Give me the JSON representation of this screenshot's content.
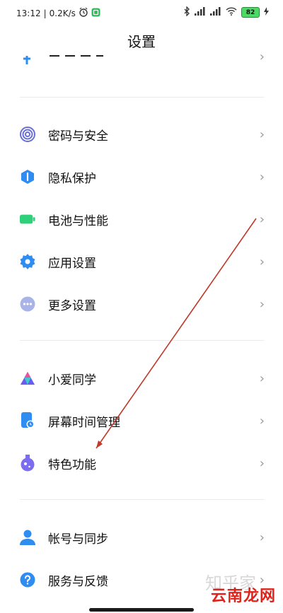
{
  "status_bar": {
    "time": "13:12",
    "net_speed": "0.2K/s",
    "battery_level": "82"
  },
  "header": {
    "title": "设置"
  },
  "sections": [
    {
      "items": [
        {
          "label": "密码与安全",
          "icon": "fingerprint-icon",
          "color": "#6a6fd8"
        },
        {
          "label": "隐私保护",
          "icon": "privacy-shield-icon",
          "color": "#2f8cf0"
        },
        {
          "label": "电池与性能",
          "icon": "battery-icon",
          "color": "#2fd07a"
        },
        {
          "label": "应用设置",
          "icon": "gear-icon",
          "color": "#2f8cf0"
        },
        {
          "label": "更多设置",
          "icon": "more-dots-icon",
          "color": "#a9b3e8"
        }
      ]
    },
    {
      "items": [
        {
          "label": "小爱同学",
          "icon": "xiaoai-icon",
          "color": "#6a5cf0"
        },
        {
          "label": "屏幕时间管理",
          "icon": "screen-time-icon",
          "color": "#2f8cf0"
        },
        {
          "label": "特色功能",
          "icon": "flask-icon",
          "color": "#7b6cf0"
        }
      ]
    },
    {
      "items": [
        {
          "label": "帐号与同步",
          "icon": "account-icon",
          "color": "#2f8cf0"
        },
        {
          "label": "服务与反馈",
          "icon": "help-icon",
          "color": "#2f8cf0"
        }
      ]
    }
  ],
  "chevron": "›",
  "watermark": "云南龙网",
  "watermark_faint": "知乎家"
}
